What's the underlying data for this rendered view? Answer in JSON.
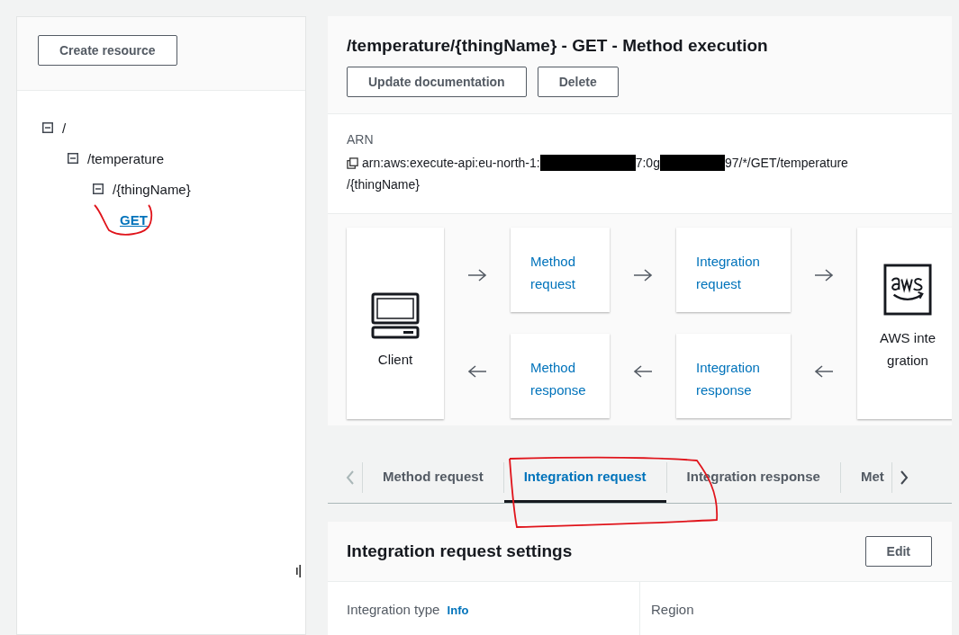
{
  "sidebar": {
    "create_button": "Create resource",
    "tree": [
      {
        "label": "/",
        "kind": "resource",
        "expanded": true,
        "children": [
          {
            "label": "/temperature",
            "kind": "resource",
            "expanded": true,
            "children": [
              {
                "label": "/{thingName}",
                "kind": "resource",
                "expanded": true,
                "children": [
                  {
                    "label": "GET",
                    "kind": "method",
                    "selected": true
                  }
                ]
              }
            ]
          }
        ]
      }
    ]
  },
  "method": {
    "title": "/temperature/{thingName} - GET - Method execution",
    "buttons": [
      "Update documentation",
      "Delete"
    ],
    "arn_label": "ARN",
    "arn_lines": [
      [
        {
          "kind": "text",
          "text": "arn:aws:execute-api:eu-north-1:"
        },
        {
          "kind": "redacted"
        },
        {
          "kind": "text",
          "text": "7:0g"
        },
        {
          "kind": "redacted"
        },
        {
          "kind": "text",
          "text": "97/*/GET/temperature"
        }
      ],
      [
        {
          "kind": "text",
          "text": "/{thingName}"
        }
      ]
    ]
  },
  "flow": {
    "client": "Client",
    "request_steps": [
      "Method request",
      "Integration request"
    ],
    "response_steps": [
      "Method response",
      "Integration response"
    ],
    "integration": "AWS integration"
  },
  "tabs": [
    {
      "label": "Method request",
      "selected": false
    },
    {
      "label": "Integration request",
      "selected": true
    },
    {
      "label": "Integration response",
      "selected": false
    },
    {
      "label": "Met",
      "selected": false
    }
  ],
  "settings": {
    "title": "Integration request settings",
    "edit_button": "Edit",
    "fields": [
      {
        "label": "Integration type",
        "info": "Info"
      },
      {
        "label": "Region"
      }
    ]
  }
}
